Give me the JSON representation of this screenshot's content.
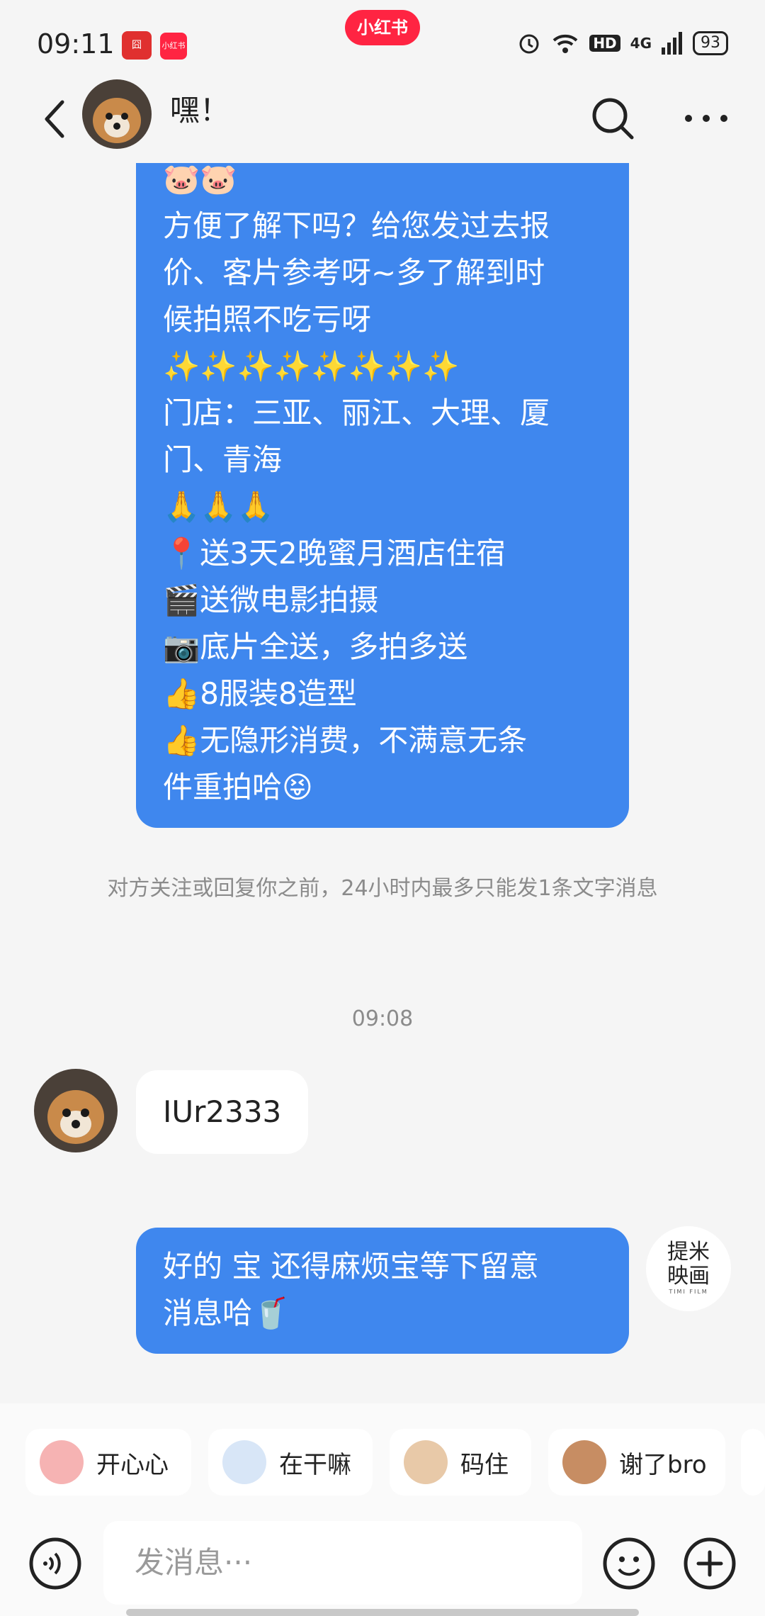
{
  "status_bar": {
    "time": "09:11",
    "app1_label": "囧",
    "app2_label": "小红书",
    "center_pill": "小红书",
    "network": "4G",
    "hd": "HD",
    "battery": "93"
  },
  "header": {
    "title": "嘿！",
    "icons": [
      "back-icon",
      "search-icon",
      "more-icon"
    ]
  },
  "messages": {
    "big_bubble_lines": [
      "🐷🐷",
      "方便了解下吗？给您发过去报",
      "价、客片参考呀~多了解到时",
      "候拍照不吃亏呀",
      "✨✨✨✨✨✨✨✨",
      "门店：三亚、丽江、大理、厦",
      "门、青海",
      "🙏🙏🙏",
      "📍送3天2晚蜜月酒店住宿",
      "🎬送微电影拍摄",
      "📷底片全送，多拍多送",
      "👍8服装8造型",
      "👍无隐形消费，不满意无条",
      "件重拍哈😝"
    ],
    "system_note": "对方关注或回复你之前，24小时内最多只能发1条文字消息",
    "timestamp": "09:08",
    "incoming_text": "IUr2333",
    "reply_line1": "好的 宝 还得麻烦宝等下留意",
    "reply_line2": "消息哈🥤",
    "right_avatar_text1": "提米",
    "right_avatar_text2": "映画",
    "right_avatar_sub": "TIMI FILM"
  },
  "quick_replies": [
    {
      "label": "开心心",
      "emoji_color": "#f6b3b3"
    },
    {
      "label": "在干嘛",
      "emoji_color": "#d8e6f7"
    },
    {
      "label": "码住",
      "emoji_color": "#e8c9a8"
    },
    {
      "label": "谢了bro",
      "emoji_color": "#c78d63"
    }
  ],
  "input": {
    "placeholder": "发消息···"
  },
  "colors": {
    "bubble_blue": "#3f87ee",
    "brand_red": "#ff2442"
  }
}
